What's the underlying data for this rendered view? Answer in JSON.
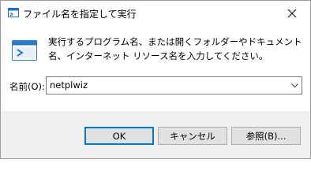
{
  "window": {
    "title": "ファイル名を指定して実行"
  },
  "content": {
    "description": "実行するプログラム名、または開くフォルダーやドキュメント名、インターネット リソース名を入力してください。",
    "open_label": "名前(O):",
    "open_value": "netplwiz"
  },
  "buttons": {
    "ok": "OK",
    "cancel": "キャンセル",
    "browse": "参照(B)..."
  },
  "colors": {
    "accent": "#0078d7",
    "footer_bg": "#f0f0f0",
    "button_bg": "#e1e1e1"
  },
  "icons": {
    "title": "run-app-icon",
    "close": "close-icon",
    "dropdown": "chevron-down-icon"
  }
}
